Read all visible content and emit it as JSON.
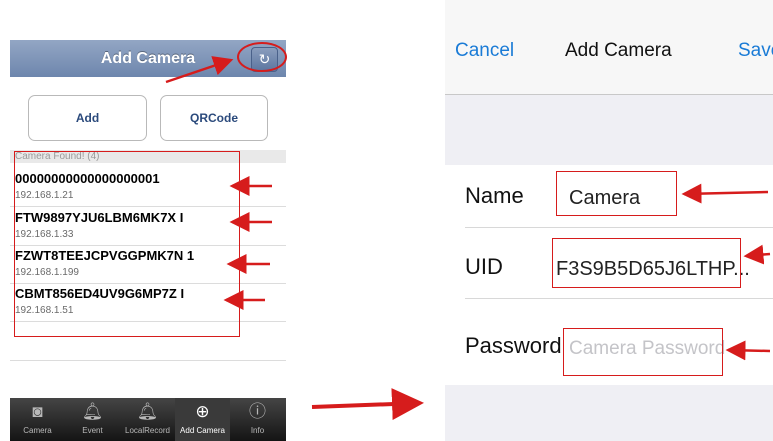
{
  "left_screen": {
    "title": "Add Camera",
    "refresh_icon": "refresh-icon",
    "add_button": "Add",
    "qrcode_button": "QRCode",
    "section_header": "Camera Found! (4)",
    "cameras": [
      {
        "uid": "00000000000000000001",
        "ip": "192.168.1.21"
      },
      {
        "uid": "FTW9897YJU6LBM6MK7X I",
        "ip": "192.168.1.33"
      },
      {
        "uid": "FZWT8TEEJCPVGGPMK7N 1",
        "ip": "192.168.1.199"
      },
      {
        "uid": "CBMT856ED4UV9G6MP7Z I",
        "ip": "192.168.1.51"
      }
    ],
    "tabs": [
      {
        "label": "Camera",
        "icon": "camera-icon"
      },
      {
        "label": "Event",
        "icon": "bell-icon"
      },
      {
        "label": "LocalRecord",
        "icon": "bell-icon"
      },
      {
        "label": "Add Camera",
        "icon": "add-camera-icon"
      },
      {
        "label": "Info",
        "icon": "info-icon"
      }
    ]
  },
  "right_screen": {
    "cancel": "Cancel",
    "title": "Add Camera",
    "save": "Save",
    "fields": {
      "name_label": "Name",
      "name_value": "Camera",
      "uid_label": "UID",
      "uid_value": "F3S9B5D65J6LTHP...",
      "password_label": "Password",
      "password_placeholder": "Camera Password"
    }
  },
  "colors": {
    "annotation_red": "#d61c1c",
    "ios_blue": "#1a7bd6",
    "nav_blue": "#6d86ad"
  }
}
